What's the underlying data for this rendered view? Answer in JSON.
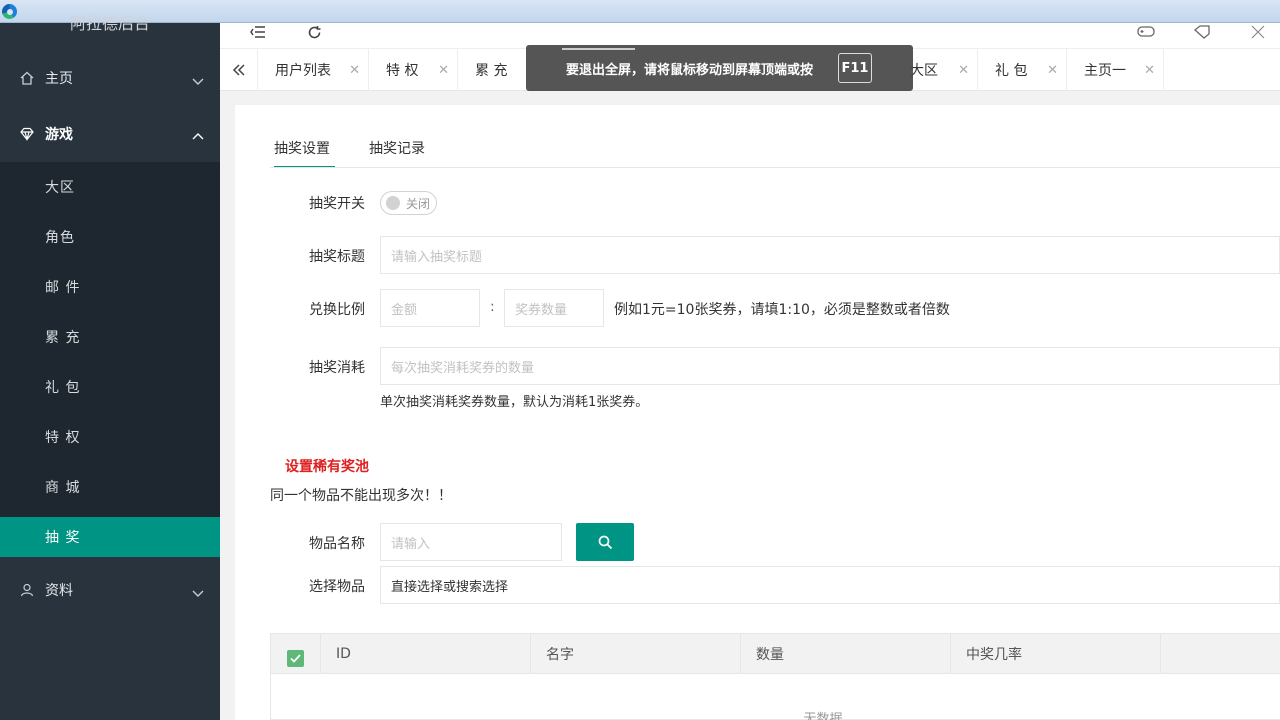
{
  "app": {
    "brand": "阿拉德后台"
  },
  "sidebar": {
    "groups": [
      {
        "label": "主页",
        "icon": "home-icon"
      },
      {
        "label": "游戏",
        "icon": "diamond-icon"
      },
      {
        "label": "资料",
        "icon": "user-icon"
      }
    ],
    "items": [
      {
        "label": "大区"
      },
      {
        "label": "角色"
      },
      {
        "label": "邮 件"
      },
      {
        "label": "累 充"
      },
      {
        "label": "礼 包"
      },
      {
        "label": "特 权"
      },
      {
        "label": "商 城"
      },
      {
        "label": "抽 奖"
      }
    ],
    "active_item": "抽 奖",
    "accent": "#009485"
  },
  "topbar": {
    "icons": [
      "menu-fold-icon",
      "refresh-icon",
      "gamepad-icon",
      "tag-icon",
      "fullscreen-icon"
    ]
  },
  "tabs": [
    {
      "label": "用户列表"
    },
    {
      "label": "特 权"
    },
    {
      "label": "累 充"
    },
    {
      "label": "大区"
    },
    {
      "label": "礼 包"
    },
    {
      "label": "主页一"
    }
  ],
  "toast": {
    "message": "要退出全屏，请将鼠标移动到屏幕顶端或按",
    "key": "F11"
  },
  "lottery": {
    "tabs": [
      "抽奖设置",
      "抽奖记录"
    ],
    "switch_label": "抽奖开关",
    "switch_state": "关闭",
    "title_label": "抽奖标题",
    "title_placeholder": "请输入抽奖标题",
    "ratio_label": "兑换比例",
    "amount_placeholder": "金额",
    "ratio_sep": ":",
    "ticket_placeholder": "奖券数量",
    "ratio_hint": "例如1元=10张奖券，请填1:10，必须是整数或者倍数",
    "cost_label": "抽奖消耗",
    "cost_placeholder": "每次抽奖消耗奖券的数量",
    "cost_hint": "单次抽奖消耗奖券数量，默认为消耗1张奖券。",
    "pool_title": "设置稀有奖池",
    "pool_warning": "同一个物品不能出现多次！！",
    "item_name_label": "物品名称",
    "item_name_placeholder": "请输入",
    "select_item_label": "选择物品",
    "select_item_value": "直接选择或搜索选择"
  },
  "table": {
    "columns": [
      "ID",
      "名字",
      "数量",
      "中奖几率"
    ],
    "empty_text": "无数据"
  }
}
